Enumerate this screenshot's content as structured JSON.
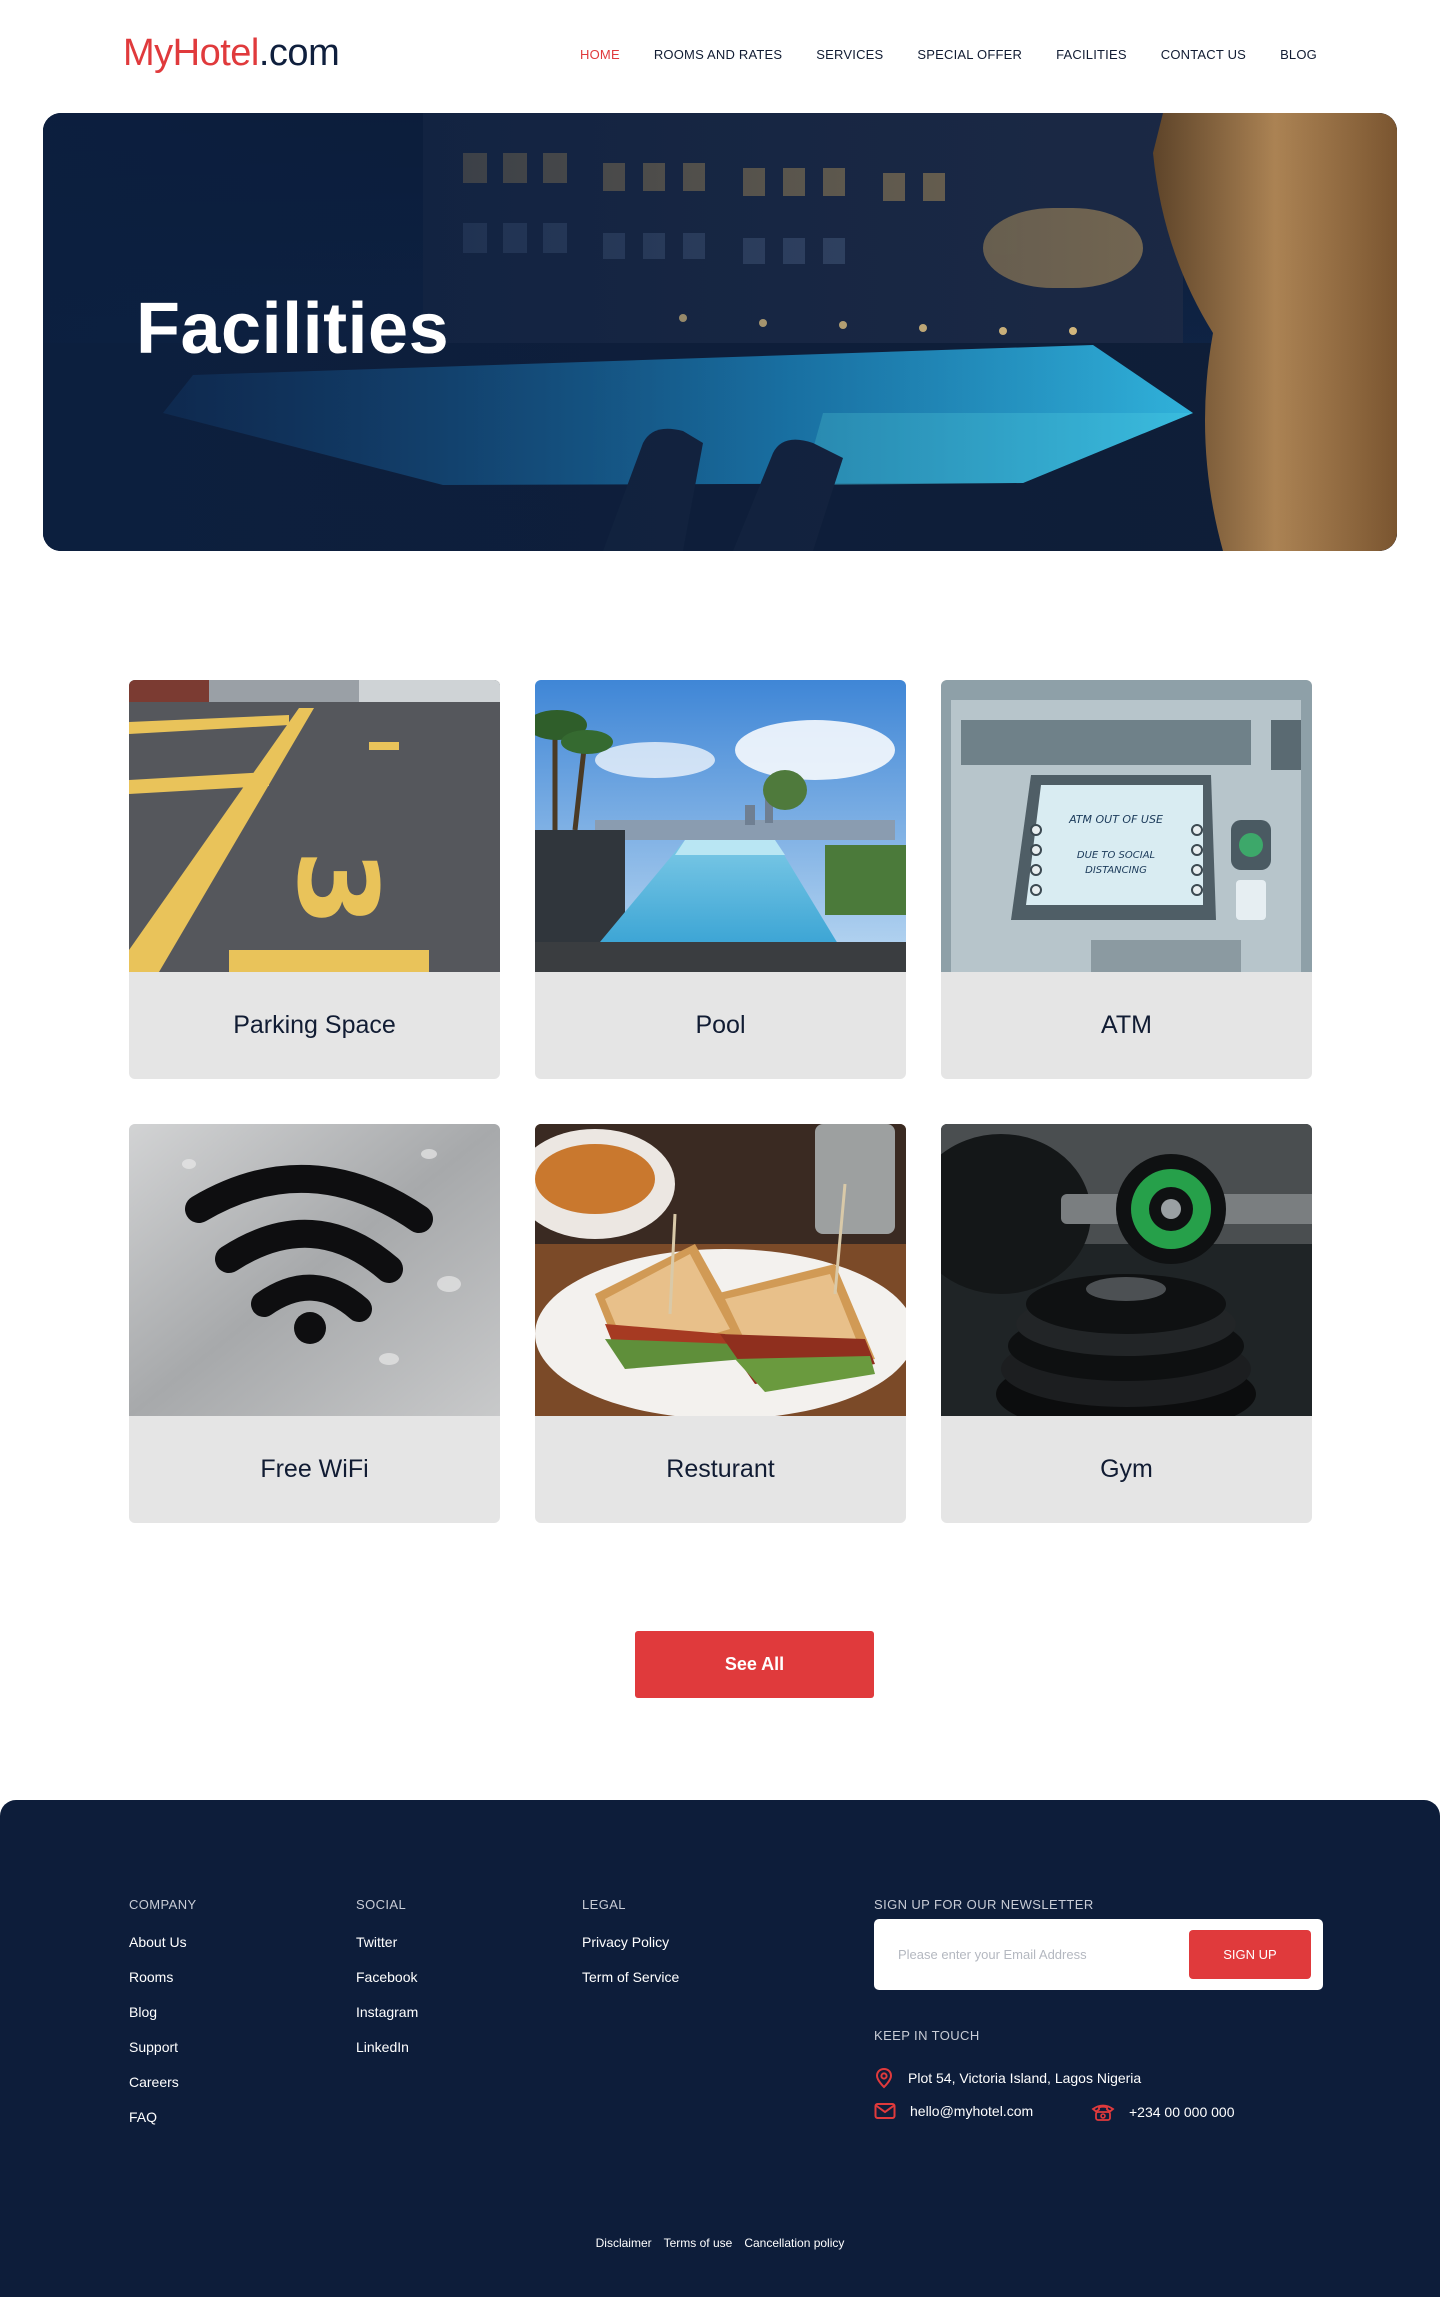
{
  "header": {
    "logo_brand": "MyHotel",
    "logo_tld": ".com",
    "nav": [
      {
        "label": "HOME",
        "active": true
      },
      {
        "label": "ROOMS AND RATES",
        "active": false
      },
      {
        "label": "SERVICES",
        "active": false
      },
      {
        "label": "SPECIAL OFFER",
        "active": false
      },
      {
        "label": "FACILITIES",
        "active": false
      },
      {
        "label": "CONTACT US",
        "active": false
      },
      {
        "label": "BLOG",
        "active": false
      }
    ]
  },
  "hero": {
    "title": "Facilities"
  },
  "facilities": [
    {
      "label": "Parking Space",
      "image": "parking-lot-photo"
    },
    {
      "label": "Pool",
      "image": "rooftop-pool-photo"
    },
    {
      "label": "ATM",
      "image": "atm-machine-photo"
    },
    {
      "label": "Free WiFi",
      "image": "wifi-symbol-photo"
    },
    {
      "label": "Resturant",
      "image": "sandwich-plate-photo"
    },
    {
      "label": "Gym",
      "image": "weight-plates-photo"
    }
  ],
  "atm_screen": {
    "line1": "ATM OUT OF USE",
    "line2": "DUE TO SOCIAL",
    "line3": "DISTANCING"
  },
  "parking_number": "3",
  "see_all_label": "See All",
  "footer": {
    "company": {
      "heading": "COMPANY",
      "items": [
        "About Us",
        "Rooms",
        "Blog",
        "Support",
        "Careers",
        "FAQ"
      ]
    },
    "social": {
      "heading": "SOCIAL",
      "items": [
        "Twitter",
        "Facebook",
        "Instagram",
        "LinkedIn"
      ]
    },
    "legal": {
      "heading": "LEGAL",
      "items": [
        "Privacy Policy",
        "Term of Service"
      ]
    },
    "newsletter": {
      "heading": "SIGN UP FOR OUR NEWSLETTER",
      "placeholder": "Please enter your Email Address",
      "value": "",
      "button": "SIGN UP"
    },
    "keep_in_touch": {
      "heading": "KEEP IN TOUCH",
      "address": "Plot 54, Victoria Island, Lagos Nigeria",
      "email": "hello@myhotel.com",
      "phone": "+234 00 000 000"
    },
    "bottom_links": [
      "Disclaimer",
      "Terms of use",
      "Cancellation policy"
    ]
  },
  "colors": {
    "accent": "#e03a3c",
    "navy": "#0d1d3a",
    "card_bg": "#e5e5e5"
  }
}
